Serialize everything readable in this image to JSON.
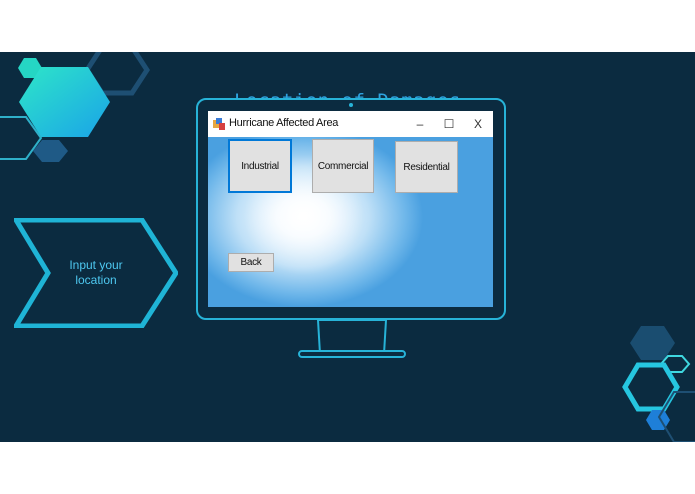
{
  "slide": {
    "title": "Location of Damages",
    "arrow_text_line1": "Input your",
    "arrow_text_line2": "location"
  },
  "window": {
    "title": "Hurricane Affected Area",
    "controls": {
      "minimize": "–",
      "maximize": "☐",
      "close": "X"
    },
    "buttons": {
      "industrial": "Industrial",
      "commercial": "Commercial",
      "residential": "Residential",
      "back": "Back"
    }
  },
  "colors": {
    "slide_background": "#0b2b40",
    "accent": "#27b3d8",
    "title_text": "#2ea3e0",
    "button_focus": "#0078d7"
  },
  "icons": [
    "app-icon",
    "minimize-icon",
    "maximize-icon",
    "close-icon"
  ]
}
